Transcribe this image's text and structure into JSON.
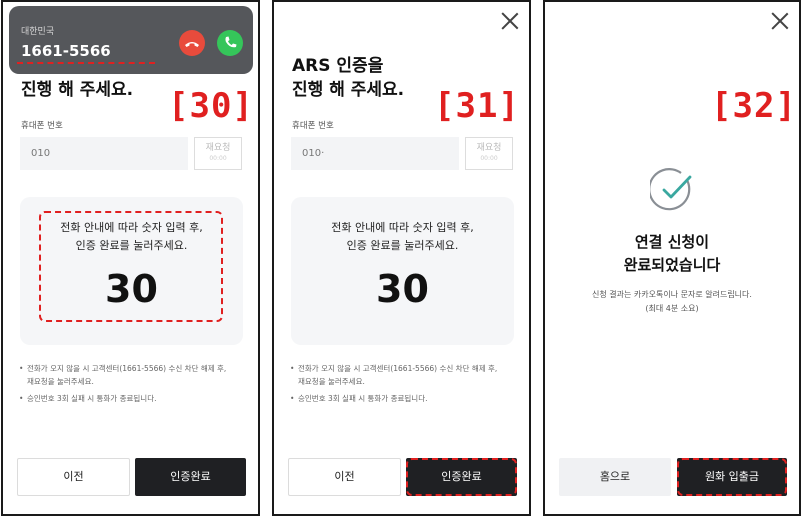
{
  "panel1": {
    "step_tag": "[30]",
    "incoming_call": {
      "country": "대한민국",
      "number": "1661-5566",
      "decline_icon": "phone-decline-icon",
      "accept_icon": "phone-accept-icon"
    },
    "title_line2": "진행 해 주세요.",
    "phone_label": "휴대폰 번호",
    "phone_value": "010",
    "resend_label": "재요청",
    "resend_sub": "00:00",
    "instruction_line1": "전화 안내에 따라 숫자 입력 후,",
    "instruction_line2": "인증 완료를 눌러주세요.",
    "code": "30",
    "note1_line1": "전화가 오지 않을 시 고객센터(1661-5566) 수신 차단 해제 후,",
    "note1_line2": "재요청을 눌러주세요.",
    "note2": "승인번호 3회 실패 시 통화가 종료됩니다.",
    "prev_button": "이전",
    "complete_button": "인증완료"
  },
  "panel2": {
    "step_tag": "[31]",
    "title_line1": "ARS 인증을",
    "title_line2": "진행 해 주세요.",
    "phone_label": "휴대폰 번호",
    "phone_value": "010·",
    "resend_label": "재요청",
    "resend_sub": "00:00",
    "instruction_line1": "전화 안내에 따라 숫자 입력 후,",
    "instruction_line2": "인증 완료를 눌러주세요.",
    "code": "30",
    "note1_line1": "전화가 오지 않을 시 고객센터(1661-5566) 수신 차단 해제 후,",
    "note1_line2": "재요청을 눌러주세요.",
    "note2": "승인번호 3회 실패 시 통화가 종료됩니다.",
    "prev_button": "이전",
    "complete_button": "인증완료"
  },
  "panel3": {
    "step_tag": "[32]",
    "title_line1": "연결 신청이",
    "title_line2": "완료되었습니다",
    "sub_line1": "신청 결과는 카카오톡이나 문자로 알려드립니다.",
    "sub_line2": "(최대 4분 소요)",
    "home_button": "홈으로",
    "krw_button": "원화 입출금"
  },
  "colors": {
    "highlight": "#e02020",
    "dark_button": "#1f2023",
    "accept_green": "#35c55a",
    "decline_red": "#e84b3c",
    "check_teal": "#3aa8a0"
  }
}
